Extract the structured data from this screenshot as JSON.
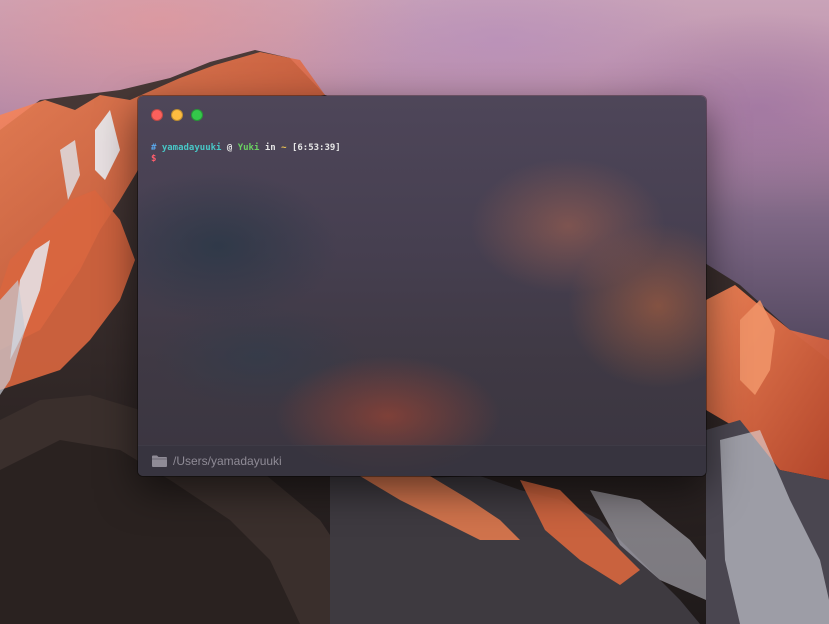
{
  "terminal": {
    "traffic_lights": {
      "close": "#fc605c",
      "minimize": "#fdbc40",
      "maximize": "#34c84a"
    },
    "prompt": {
      "hash": "#",
      "user": "yamadayuuki",
      "at": "@",
      "host": "Yuki",
      "in": "in",
      "dir": "~",
      "time": "[6:53:39]",
      "dollar": "$"
    },
    "status": {
      "icon": "folder-icon",
      "path": "/Users/yamadayuuki"
    }
  }
}
